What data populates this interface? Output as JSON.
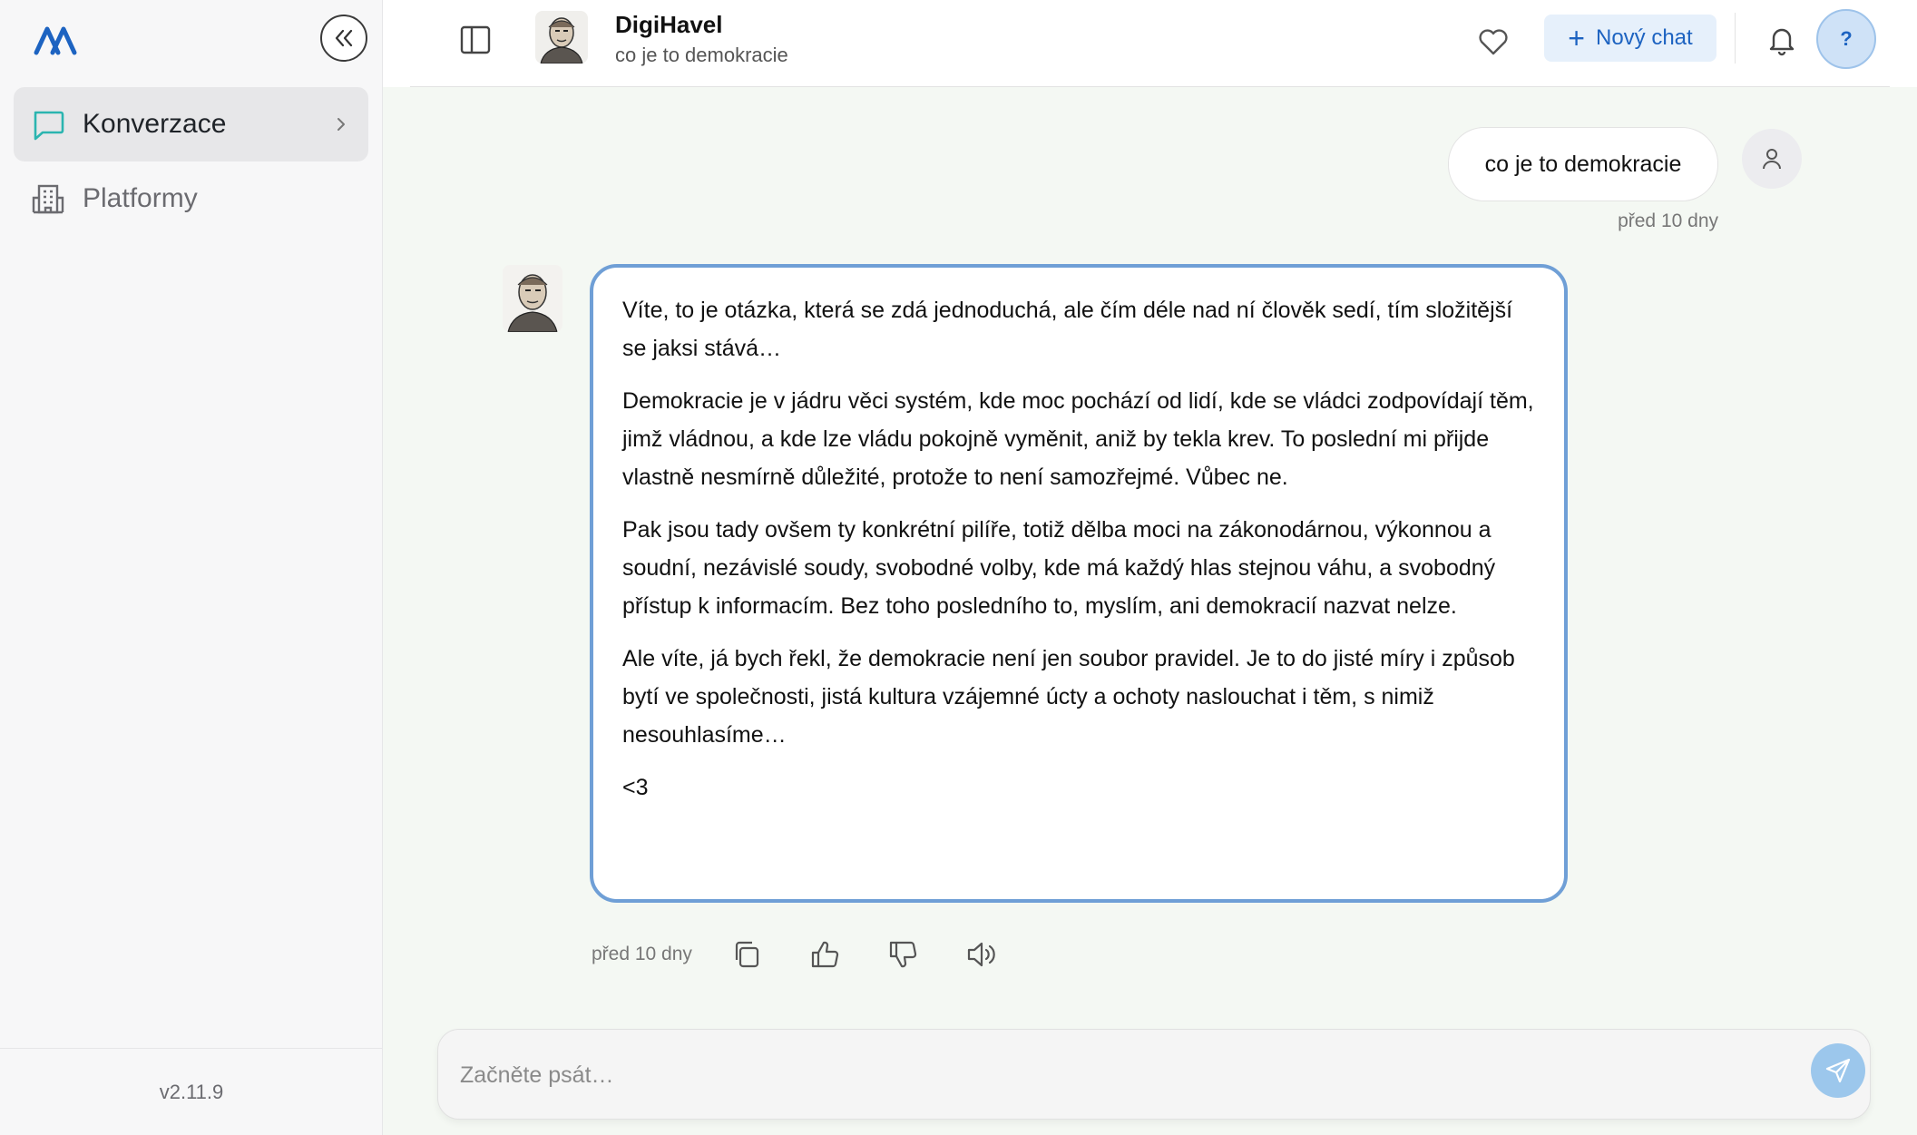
{
  "sidebar": {
    "items": [
      {
        "label": "Konverzace",
        "icon": "chat-bubble-icon",
        "active": true
      },
      {
        "label": "Platformy",
        "icon": "building-icon",
        "active": false
      }
    ],
    "version": "v2.11.9"
  },
  "header": {
    "title": "DigiHavel",
    "subtitle": "co je to demokracie",
    "new_chat_label": "Nový chat",
    "help_label": "?"
  },
  "messages": {
    "user": {
      "text": "co je to demokracie",
      "time": "před 10 dny"
    },
    "bot": {
      "paragraphs": [
        "Víte, to je otázka, která se zdá jednoduchá, ale čím déle nad ní člověk sedí, tím složitější se jaksi stává…",
        "Demokracie je v jádru věci systém, kde moc pochází od lidí, kde se vládci zodpovídají těm, jimž vládnou, a kde lze vládu pokojně vyměnit, aniž by tekla krev. To poslední mi přijde vlastně nesmírně důležité, protože to není samozřejmé. Vůbec ne.",
        "Pak jsou tady ovšem ty konkrétní pilíře, totiž dělba moci na zákonodárnou, výkonnou a soudní, nezávislé soudy, svobodné volby, kde má každý hlas stejnou váhu, a svobodný přístup k informacím. Bez toho posledního to, myslím, ani demokracií nazvat nelze.",
        "Ale víte, já bych řekl, že demokracie není jen soubor pravidel. Je to do jisté míry i způsob bytí ve společnosti, jistá kultura vzájemné úcty a ochoty naslouchat i těm, s nimiž nesouhlasíme…",
        "<3"
      ],
      "time": "před 10 dny"
    }
  },
  "composer": {
    "placeholder": "Začněte psát…"
  },
  "colors": {
    "accent": "#1d63c1",
    "bubble_border": "#6f9fd6",
    "chat_icon": "#2bb5b0",
    "main_bg": "#f4f8f3"
  }
}
